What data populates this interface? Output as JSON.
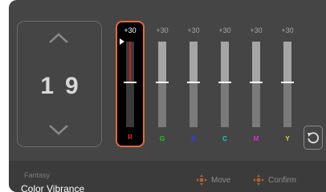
{
  "adjust": {
    "value": "19"
  },
  "sliders": [
    {
      "label": "+30",
      "letter": "R",
      "letter_color": "#e03030",
      "level": 0.53,
      "selected": true
    },
    {
      "label": "+30",
      "letter": "G",
      "letter_color": "#22c322",
      "level": 0.53,
      "selected": false
    },
    {
      "label": "+30",
      "letter": "B",
      "letter_color": "#2f3fe8",
      "level": 0.53,
      "selected": false
    },
    {
      "label": "+30",
      "letter": "C",
      "letter_color": "#22c3d6",
      "level": 0.53,
      "selected": false
    },
    {
      "label": "+30",
      "letter": "M",
      "letter_color": "#d62fc8",
      "level": 0.53,
      "selected": false
    },
    {
      "label": "+30",
      "letter": "Y",
      "letter_color": "#e6d62a",
      "level": 0.53,
      "selected": false
    }
  ],
  "footer": {
    "preset": "Fantasy",
    "title": "Color Vibrance",
    "move_label": "Move",
    "confirm_label": "Confirm"
  },
  "icons": {
    "up": "chevron-up-icon",
    "down": "chevron-down-icon",
    "reset": "reset-icon",
    "pointer": "pointer-triangle-icon",
    "dpad": "dpad-icon"
  },
  "colors": {
    "accent": "#e06a3a",
    "panel": "#454545",
    "footer": "#3b3b3b"
  }
}
